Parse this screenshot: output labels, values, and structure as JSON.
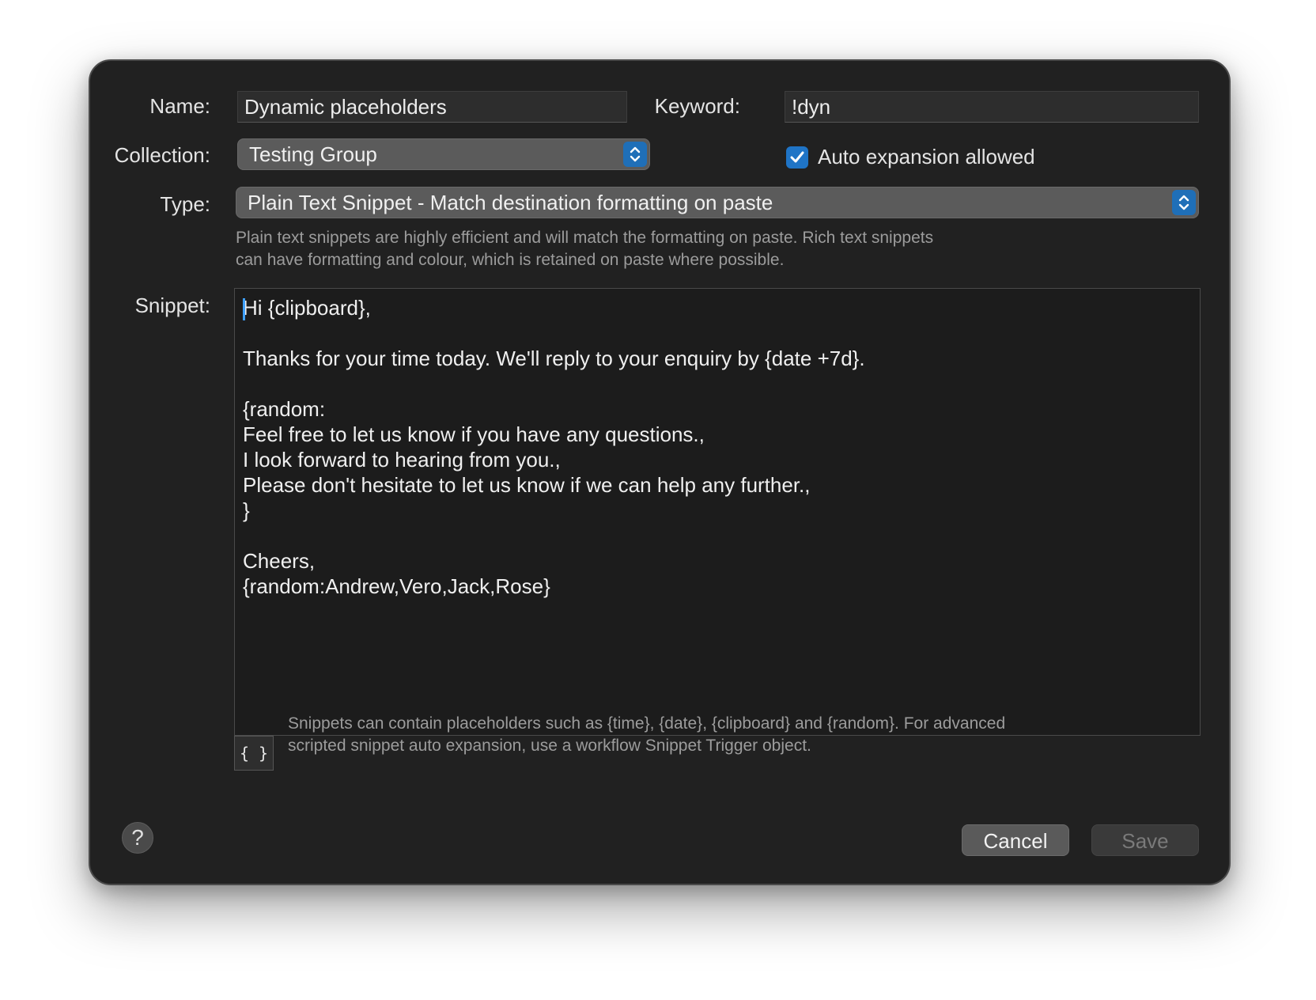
{
  "form": {
    "name_label": "Name:",
    "name_value": "Dynamic placeholders",
    "keyword_label": "Keyword:",
    "keyword_value": "!dyn",
    "collection_label": "Collection:",
    "collection_value": "Testing Group",
    "auto_expansion_label": "Auto expansion allowed",
    "auto_expansion_checked": true,
    "type_label": "Type:",
    "type_value": "Plain Text Snippet - Match destination formatting on paste",
    "type_help_line1": "Plain text snippets are highly efficient and will match the formatting on paste. Rich text snippets",
    "type_help_line2": "can have formatting and colour, which is retained on paste where possible.",
    "snippet_label": "Snippet:"
  },
  "snippet": {
    "lines": [
      "Hi {clipboard},",
      "",
      "Thanks for your time today. We'll reply to your enquiry by {date +7d}.",
      "",
      "{random:",
      "Feel free to let us know if you have any questions.,",
      "I look forward to hearing from you.,",
      "Please don't hesitate to let us know if we can help any further.,",
      "}",
      "",
      "Cheers,",
      "{random:Andrew,Vero,Jack,Rose}"
    ]
  },
  "placeholder_button": {
    "label": "{ }"
  },
  "placeholder_help": {
    "line1": "Snippets can contain placeholders such as {time}, {date}, {clipboard} and {random}. For advanced",
    "line2": "scripted snippet auto expansion, use a workflow Snippet Trigger object."
  },
  "footer": {
    "help_label": "?",
    "cancel_label": "Cancel",
    "save_label": "Save"
  },
  "colors": {
    "dialog_bg": "#212121",
    "accent": "#1f74c6",
    "popup_bg": "#5b5b5b"
  },
  "icons": {
    "collection_stepper": "chevron-up-down-icon",
    "type_stepper": "chevron-up-down-icon",
    "checkbox": "checkmark-icon"
  }
}
